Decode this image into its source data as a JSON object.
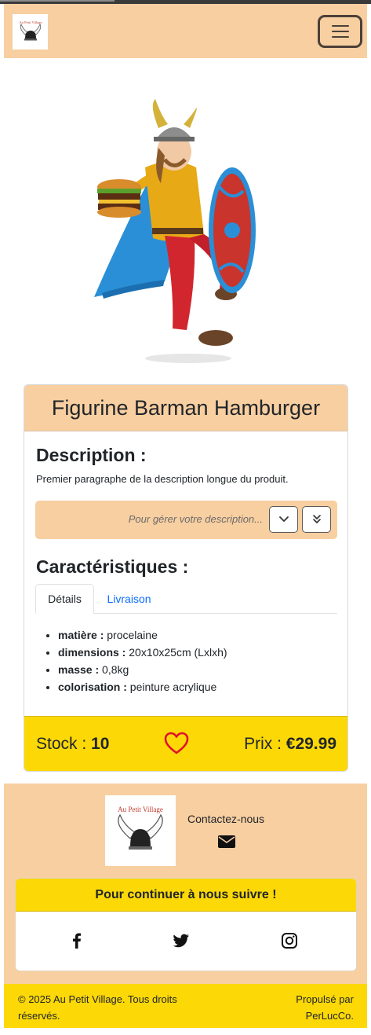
{
  "navbar": {
    "logo_alt": "Au Petit Village",
    "logo_text": "Au Petit Village",
    "menu_icon": "hamburger-menu-icon"
  },
  "product": {
    "image_alt": "Viking figurine holding a hamburger and a shield",
    "title": "Figurine Barman Hamburger",
    "description_title": "Description :",
    "description_text": "Premier paragraphe de la description longue du produit.",
    "description_hint": "Pour gérer votre description...",
    "expand_icon": "chevron-down-icon",
    "expand_all_icon": "chevrons-double-down-icon",
    "characteristics_title": "Caractéristiques :",
    "tabs": [
      {
        "label": "Détails",
        "active": true
      },
      {
        "label": "Livraison",
        "active": false
      }
    ],
    "specs": [
      {
        "key": "matière :",
        "value": "procelaine"
      },
      {
        "key": "dimensions :",
        "value": "20x10x25cm (Lxlxh)"
      },
      {
        "key": "masse :",
        "value": "0,8kg"
      },
      {
        "key": "colorisation :",
        "value": "peinture acrylique"
      }
    ],
    "stock_label": "Stock : ",
    "stock_value": "10",
    "favorite_icon": "heart-outline-icon",
    "price_label": "Prix : ",
    "price_value": "€29.99"
  },
  "footer": {
    "logo_text": "Au Petit Village",
    "contact_label": "Contactez-nous",
    "contact_icon": "envelope-icon",
    "follow_title": "Pour continuer à nous suivre !",
    "social": [
      "facebook-icon",
      "twitter-icon",
      "instagram-icon"
    ],
    "copyright": "© 2025 Au Petit Village. Tous droits réservés.",
    "powered": "Propulsé par PerLucCo."
  },
  "colors": {
    "peach": "#f8cfa1",
    "yellow": "#fcd807",
    "heart": "#e0102d",
    "link": "#0d6efd"
  }
}
